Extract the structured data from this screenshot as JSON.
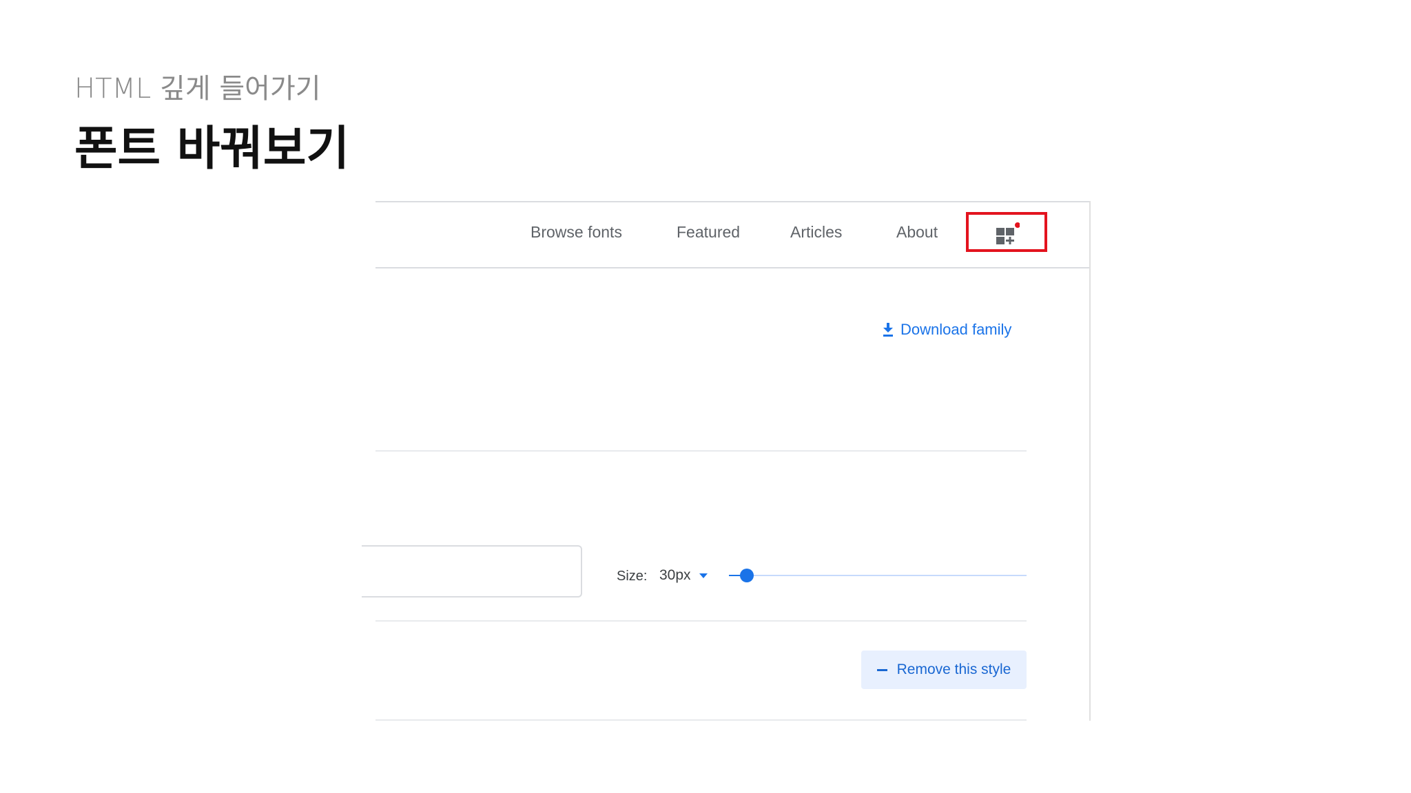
{
  "slide": {
    "subtitle": "HTML 깊게 들어가기",
    "title": "폰트 바꿔보기"
  },
  "nav": {
    "items": [
      {
        "label": "Browse fonts"
      },
      {
        "label": "Featured"
      },
      {
        "label": "Articles"
      },
      {
        "label": "About"
      }
    ],
    "selection_icon": "font-selection-grid-plus-icon",
    "selection_badge_color": "#e3131e",
    "highlight_color": "#e3131e"
  },
  "download": {
    "label": "Download family",
    "icon": "download-icon",
    "color": "#1a73e8"
  },
  "preview": {
    "input_value": "",
    "size_label": "Size:",
    "size_value": "30px",
    "slider_fraction": 0.06
  },
  "style_actions": {
    "remove_label": "Remove this style",
    "icon": "minus-icon"
  },
  "colors": {
    "accent": "#1a73e8",
    "nav_text": "#5f6368",
    "divider": "#e8eaed",
    "remove_bg": "#e8f0fe"
  }
}
